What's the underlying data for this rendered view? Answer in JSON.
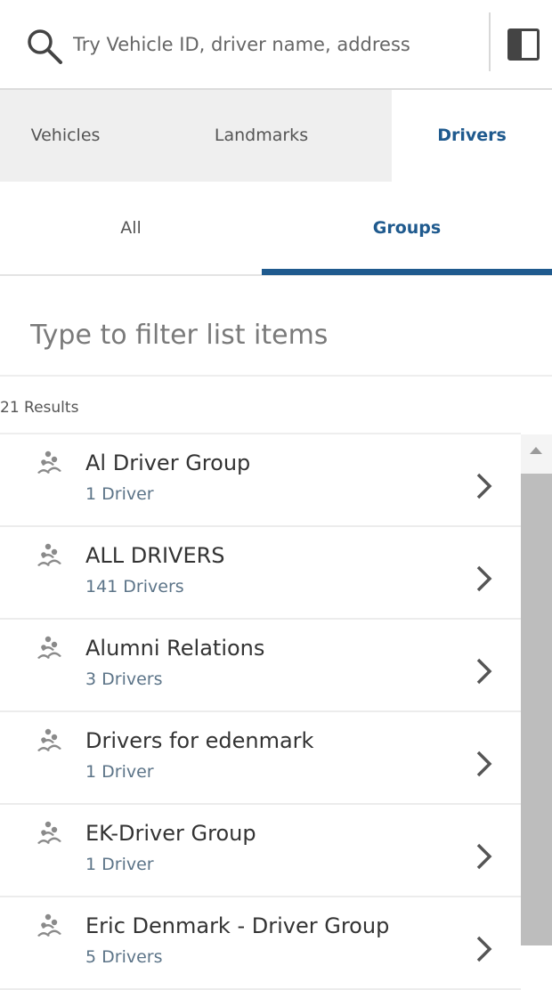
{
  "search": {
    "placeholder": "Try Vehicle ID, driver name, address",
    "icon": "search-icon"
  },
  "panel_toggle": {
    "icon": "panel-toggle-icon"
  },
  "main_tabs": [
    {
      "label": "Vehicles",
      "active": false
    },
    {
      "label": "Landmarks",
      "active": false
    },
    {
      "label": "Drivers",
      "active": true
    }
  ],
  "sub_tabs": [
    {
      "label": "All",
      "active": false
    },
    {
      "label": "Groups",
      "active": true
    }
  ],
  "filter": {
    "placeholder": "Type to filter list items"
  },
  "results": {
    "count_label": "21 Results"
  },
  "groups": [
    {
      "name": "Al Driver Group",
      "count": "1 Driver"
    },
    {
      "name": "ALL DRIVERS",
      "count": "141 Drivers"
    },
    {
      "name": "Alumni Relations",
      "count": "3 Drivers"
    },
    {
      "name": "Drivers for edenmark",
      "count": "1 Driver"
    },
    {
      "name": "EK-Driver Group",
      "count": "1 Driver"
    },
    {
      "name": "Eric Denmark - Driver Group",
      "count": "5 Drivers"
    }
  ],
  "colors": {
    "accent": "#1f5a8e",
    "tab_bg": "#efefef",
    "scroll_thumb": "#bdbdbd"
  }
}
